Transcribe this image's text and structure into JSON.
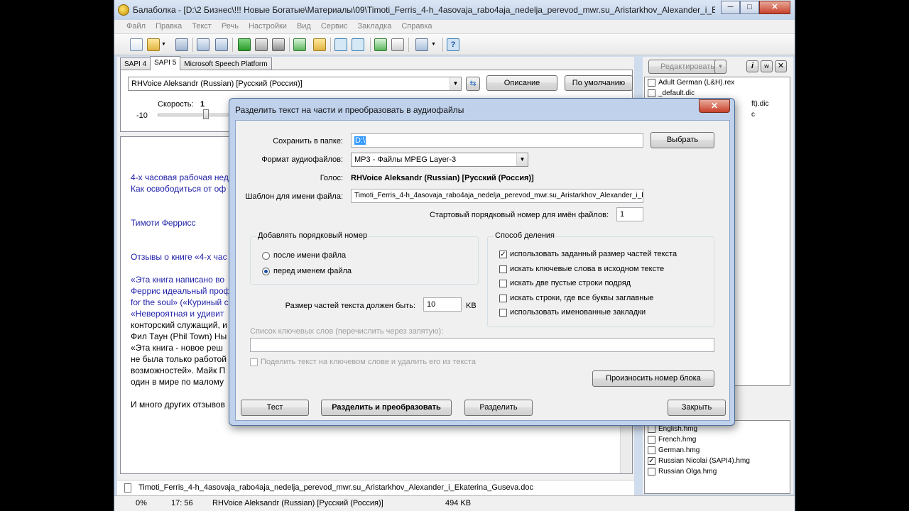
{
  "window": {
    "title": "Балаболка - [D:\\2 Бизнес\\!!! Новые Богатые\\Материалы\\09\\Timoti_Ferris_4-h_4asovaja_rabo4aja_nedelja_perevod_mwr.su_Aristarkhov_Alexander_i_Ekaterina_Guse...",
    "min": "─",
    "max": "□",
    "close": "✕"
  },
  "menu": [
    "Файл",
    "Правка",
    "Текст",
    "Речь",
    "Настройки",
    "Вид",
    "Сервис",
    "Закладка",
    "Справка"
  ],
  "tabs": [
    "SAPI 4",
    "SAPI 5",
    "Microsoft Speech Platform"
  ],
  "voice": {
    "selected": "RHVoice Aleksandr (Russian) [Русский (Россия)]",
    "description_btn": "Описание",
    "default_btn": "По умолчанию",
    "speed_label": "Скорость:",
    "speed_value": "1",
    "speed_min": "-10"
  },
  "text_lines": [
    {
      "t": "4-х часовая рабочая нед",
      "blue": true
    },
    {
      "t": "Как освободиться от оф",
      "blue": true
    },
    {
      "t": "Тимоти Феррисс",
      "blue": true
    },
    {
      "t": "Отзывы о книге «4-х час",
      "blue": true
    },
    {
      "t": "«Эта книга написано во",
      "blue": true
    },
    {
      "t": "Феррис идеальный проф",
      "blue": true
    },
    {
      "t": "for the soul» («Куриный с",
      "blue": true
    },
    {
      "t": "«Невероятная и удивит",
      "blue": true
    },
    {
      "t": "конторский служащий, и",
      "blue": false
    },
    {
      "t": "Фил Таун (Phil Town) Ны",
      "blue": false
    },
    {
      "t": " «Эта книга - новое реш",
      "blue": false
    },
    {
      "t": "не была только работой",
      "blue": false
    },
    {
      "t": "возможностей». Майк П",
      "blue": false
    },
    {
      "t": "один в мире по малому",
      "blue": false
    },
    {
      "t": "И много других отзывов",
      "blue": false
    }
  ],
  "file_tab": "Timoti_Ferris_4-h_4asovaja_rabo4aja_nedelja_perevod_mwr.su_Aristarkhov_Alexander_i_Ekaterina_Guseva.doc",
  "status": {
    "percent": "0%",
    "position": "17:  56",
    "voice": "RHVoice Aleksandr (Russian) [Русский (Россия)]",
    "size": "494 KB"
  },
  "right_panel": {
    "edit_btn": "Редактировать",
    "dicts": [
      {
        "name": "Adult German (L&H).rex",
        "checked": false
      },
      {
        "name": "_default.dic",
        "checked": false
      },
      {
        "name": "ft).dic",
        "checked": false
      },
      {
        "name": "c",
        "checked": false
      }
    ],
    "hmg": [
      {
        "name": "English.hmg",
        "checked": false
      },
      {
        "name": "French.hmg",
        "checked": false
      },
      {
        "name": "German.hmg",
        "checked": false
      },
      {
        "name": "Russian Nicolai (SAPI4).hmg",
        "checked": true
      },
      {
        "name": "Russian Olga.hmg",
        "checked": false
      }
    ]
  },
  "dialog": {
    "title": "Разделить текст на части и преобразовать в аудиофайлы",
    "save_folder_label": "Сохранить в папке:",
    "save_folder_value": "D:\\",
    "choose_btn": "Выбрать",
    "format_label": "Формат аудиофайлов:",
    "format_value": "MP3 - Файлы MPEG Layer-3",
    "voice_label": "Голос:",
    "voice_value": "RHVoice Aleksandr (Russian) [Русский (Россия)]",
    "template_label": "Шаблон для имени файла:",
    "template_value": "Timoti_Ferris_4-h_4asovaja_rabo4aja_nedelja_perevod_mwr.su_Aristarkhov_Alexander_i_Ek",
    "start_label": "Стартовый порядковый номер для имён файлов:",
    "start_value": "1",
    "number_group": "Добавлять порядковый номер",
    "radio_after": "после имени файла",
    "radio_before": "перед именем файла",
    "split_group": "Способ деления",
    "split_options": [
      {
        "label": "использовать заданный размер частей текста",
        "checked": true
      },
      {
        "label": "искать ключевые слова в исходном тексте",
        "checked": false
      },
      {
        "label": "искать две пустые строки подряд",
        "checked": false
      },
      {
        "label": "искать строки, где все буквы заглавные",
        "checked": false
      },
      {
        "label": "использовать именованные закладки",
        "checked": false
      }
    ],
    "size_label": "Размер частей текста должен быть:",
    "size_value": "10",
    "size_unit": "KB",
    "keywords_label": "Список ключевых слов (перечислить через запятую):",
    "keywords_value": "",
    "split_on_keyword": "Поделить текст на ключевом слове и удалить его из текста",
    "speak_block_btn": "Произносить номер блока",
    "test_btn": "Тест",
    "split_convert_btn": "Разделить и преобразовать",
    "split_btn": "Разделить",
    "close_btn": "Закрыть"
  }
}
